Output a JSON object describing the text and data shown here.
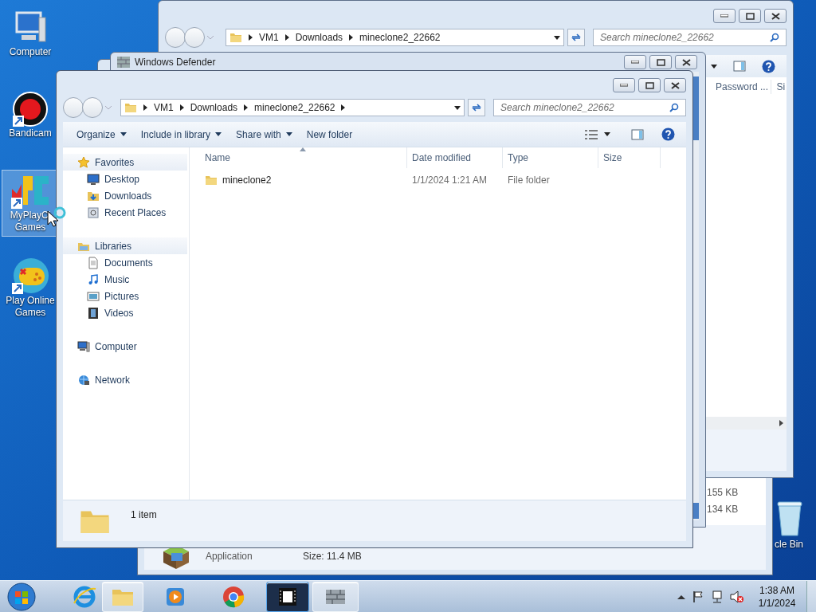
{
  "desktop_icons": [
    {
      "kind": "computer",
      "lines": [
        "Computer"
      ],
      "selected": false
    },
    {
      "kind": "bandicam",
      "lines": [
        "Bandicam"
      ],
      "selected": false
    },
    {
      "kind": "myplaycity",
      "lines": [
        "MyPlayCi",
        "Games"
      ],
      "selected": true
    },
    {
      "kind": "gamepad",
      "lines": [
        "Play Online",
        "Games"
      ],
      "selected": false
    }
  ],
  "recycle_bin": {
    "label": "cle Bin"
  },
  "details_window": {
    "sizes": [
      "155 KB",
      "134 KB"
    ],
    "file_type": "Application",
    "file_size": "Size: 11.4 MB"
  },
  "back_explorer": {
    "path": [
      "VM1",
      "Downloads",
      "mineclone2_22662"
    ],
    "search_placeholder": "Search mineclone2_22662",
    "columns": [
      "Password ...",
      "Si"
    ]
  },
  "defender_window": {
    "title": "Windows Defender"
  },
  "explorer": {
    "path": [
      "VM1",
      "Downloads",
      "mineclone2_22662"
    ],
    "search_placeholder": "Search mineclone2_22662",
    "toolbar": [
      {
        "label": "Organize",
        "dropdown": true
      },
      {
        "label": "Include in library",
        "dropdown": true
      },
      {
        "label": "Share with",
        "dropdown": true
      },
      {
        "label": "New folder",
        "dropdown": false
      }
    ],
    "nav": [
      {
        "label": "Favorites",
        "kind": "star",
        "children": [
          {
            "label": "Desktop",
            "kind": "desktop"
          },
          {
            "label": "Downloads",
            "kind": "downloads"
          },
          {
            "label": "Recent Places",
            "kind": "recent"
          }
        ]
      },
      {
        "label": "Libraries",
        "kind": "library",
        "children": [
          {
            "label": "Documents",
            "kind": "documents"
          },
          {
            "label": "Music",
            "kind": "music"
          },
          {
            "label": "Pictures",
            "kind": "pictures"
          },
          {
            "label": "Videos",
            "kind": "videos"
          }
        ]
      },
      {
        "label": "Computer",
        "kind": "computer"
      },
      {
        "label": "Network",
        "kind": "network"
      }
    ],
    "columns": [
      "Name",
      "Date modified",
      "Type",
      "Size"
    ],
    "rows": [
      {
        "name": "mineclone2",
        "date": "1/1/2024 1:21 AM",
        "type": "File folder",
        "size": ""
      }
    ],
    "status": "1 item"
  },
  "taskbar": {
    "apps": [
      {
        "kind": "ie",
        "running": false,
        "selected": false
      },
      {
        "kind": "explorer",
        "running": true,
        "selected": false
      },
      {
        "kind": "media",
        "running": false,
        "selected": false
      },
      {
        "kind": "chrome",
        "running": false,
        "selected": false
      },
      {
        "kind": "film",
        "running": true,
        "selected": true
      },
      {
        "kind": "wall",
        "running": true,
        "selected": false
      }
    ],
    "time": "1:38 AM",
    "date": "1/1/2024"
  }
}
